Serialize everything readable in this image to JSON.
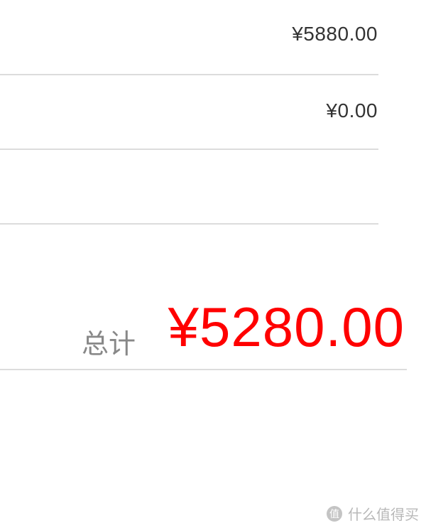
{
  "rows": [
    {
      "value": "¥5880.00"
    },
    {
      "value": "¥0.00"
    },
    {
      "value": ""
    }
  ],
  "total": {
    "label": "总计",
    "value": "¥5280.00",
    "color": "#ff0000"
  },
  "watermark": {
    "icon": "zhide-logo-icon",
    "text": "什么值得买"
  }
}
